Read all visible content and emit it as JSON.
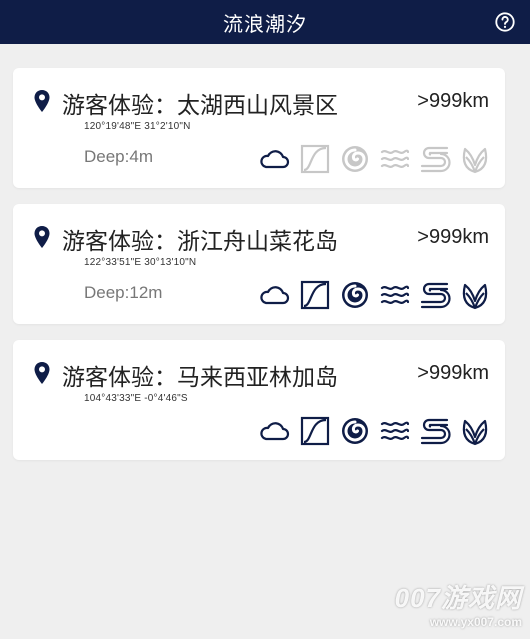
{
  "header": {
    "title": "流浪潮汐"
  },
  "cards": [
    {
      "name": "游客体验：太湖西山风景区",
      "coords": "120°19'48\"E  31°2'10\"N",
      "distance": ">999km",
      "depth": "Deep:4m",
      "icons": [
        {
          "icon": "cloud-icon",
          "active": true
        },
        {
          "icon": "tide-curve-icon",
          "active": false
        },
        {
          "icon": "swirl-icon",
          "active": false
        },
        {
          "icon": "waves-icon",
          "active": false
        },
        {
          "icon": "current-icon",
          "active": false
        },
        {
          "icon": "seaweed-icon",
          "active": false
        }
      ]
    },
    {
      "name": "游客体验：浙江舟山菜花岛",
      "coords": "122°33'51\"E  30°13'10\"N",
      "distance": ">999km",
      "depth": "Deep:12m",
      "icons": [
        {
          "icon": "cloud-icon",
          "active": true
        },
        {
          "icon": "tide-curve-icon",
          "active": true
        },
        {
          "icon": "swirl-icon",
          "active": true
        },
        {
          "icon": "waves-icon",
          "active": true
        },
        {
          "icon": "current-icon",
          "active": true
        },
        {
          "icon": "seaweed-icon",
          "active": true
        }
      ]
    },
    {
      "name": "游客体验：马来西亚林加岛",
      "coords": "104°43'33\"E  -0°4'46\"S",
      "distance": ">999km",
      "depth": "",
      "icons": [
        {
          "icon": "cloud-icon",
          "active": true
        },
        {
          "icon": "tide-curve-icon",
          "active": true
        },
        {
          "icon": "swirl-icon",
          "active": true
        },
        {
          "icon": "waves-icon",
          "active": true
        },
        {
          "icon": "current-icon",
          "active": true
        },
        {
          "icon": "seaweed-icon",
          "active": true
        }
      ]
    }
  ],
  "watermark": {
    "main": "007游戏网",
    "sub": "www.yx007.com"
  },
  "colors": {
    "header": "#0f1d47",
    "icon_active": "#0f1d47",
    "icon_inactive": "#c7c7c7",
    "background": "#efefef"
  }
}
